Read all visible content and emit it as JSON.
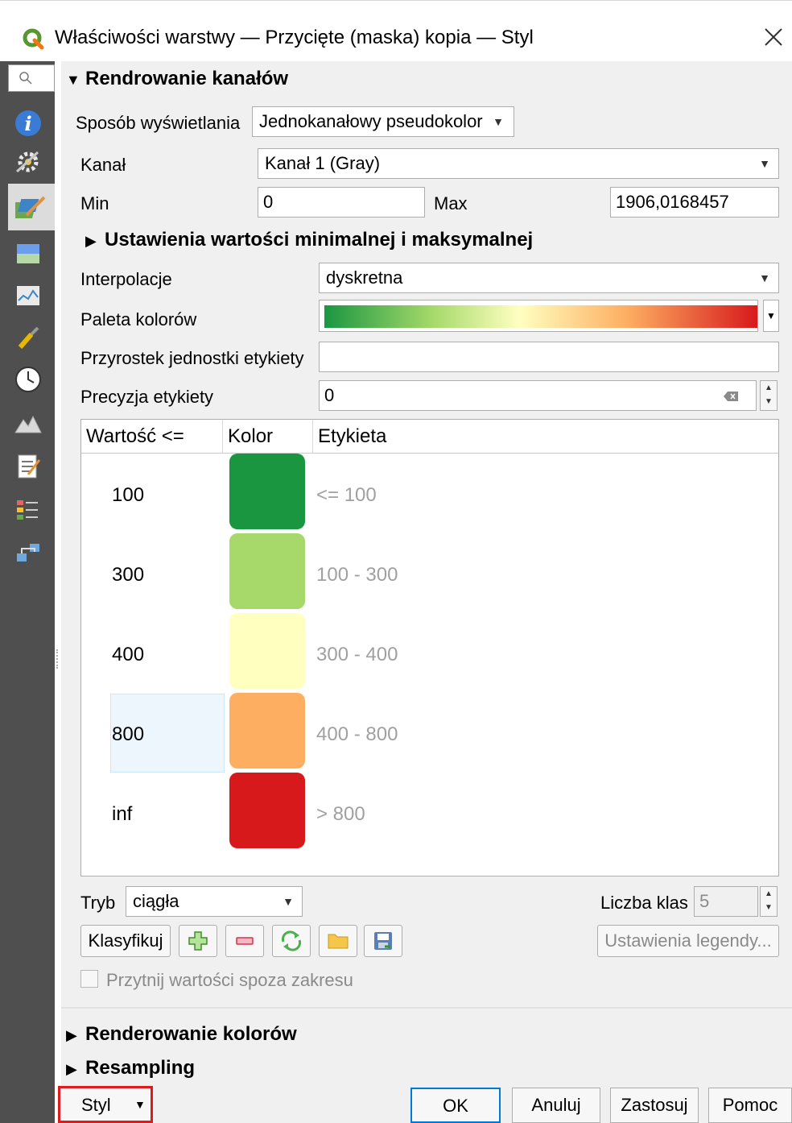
{
  "window": {
    "title": "Właściwości warstwy — Przycięte (maska) kopia — Styl"
  },
  "sidebar": {
    "items": [
      "search-icon",
      "info-icon",
      "settings-icon",
      "symbology-icon",
      "transparency-icon",
      "histogram-icon",
      "rendering-icon",
      "temporal-icon",
      "elevation-icon",
      "metadata-icon",
      "legend-icon",
      "server-icon"
    ]
  },
  "band_rendering": {
    "section_title": "Rendrowanie kanałów",
    "render_type_label": "Sposób wyświetlania",
    "render_type_value": "Jednokanałowy pseudokolor",
    "band_label": "Kanał",
    "band_value": "Kanał 1 (Gray)",
    "min_label": "Min",
    "min_value": "0",
    "max_label": "Max",
    "max_value": "1906,0168457",
    "minmax_section": "Ustawienia wartości minimalnej i maksymalnej",
    "interpolation_label": "Interpolacje",
    "interpolation_value": "dyskretna",
    "ramp_label": "Paleta kolorów",
    "suffix_label": "Przyrostek jednostki etykiety",
    "suffix_value": "",
    "precision_label": "Precyzja etykiety",
    "precision_value": "0"
  },
  "table": {
    "headers": [
      "Wartość <=",
      "Kolor",
      "Etykieta"
    ],
    "rows": [
      {
        "value": "100",
        "color": "#1a9641",
        "label": "<= 100"
      },
      {
        "value": "300",
        "color": "#a6d96a",
        "label": "100 - 300"
      },
      {
        "value": "400",
        "color": "#ffffc0",
        "label": "300 - 400"
      },
      {
        "value": "800",
        "color": "#fdae61",
        "label": "400 - 800"
      },
      {
        "value": "inf",
        "color": "#d7191c",
        "label": "> 800"
      }
    ]
  },
  "mode": {
    "label": "Tryb",
    "value": "ciągła",
    "classes_label": "Liczba klas",
    "classes_value": "5"
  },
  "actions": {
    "classify": "Klasyfikuj",
    "legend_settings": "Ustawienia legendy...",
    "clip_label": "Przytnij wartości spoza zakresu"
  },
  "sections": {
    "color_rendering": "Renderowanie kolorów",
    "resampling": "Resampling"
  },
  "footer": {
    "style": "Styl",
    "ok": "OK",
    "cancel": "Anuluj",
    "apply": "Zastosuj",
    "help": "Pomoc"
  }
}
